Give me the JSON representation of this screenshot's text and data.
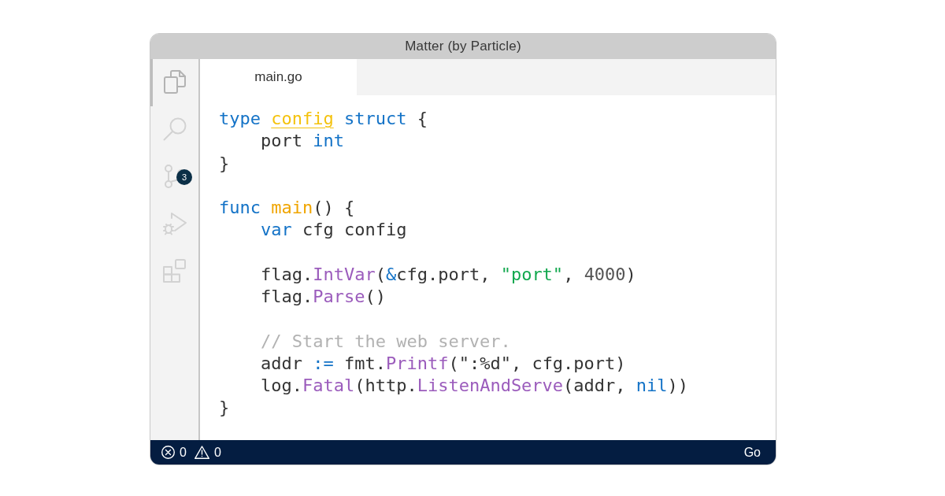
{
  "window": {
    "title": "Matter (by Particle)"
  },
  "activity_bar": {
    "items": [
      {
        "kind": "files",
        "selected": true
      },
      {
        "kind": "search",
        "selected": false
      },
      {
        "kind": "branch",
        "selected": false,
        "badge": "3"
      },
      {
        "kind": "debug",
        "selected": false
      },
      {
        "kind": "extensions",
        "selected": false
      }
    ]
  },
  "tabs": [
    {
      "label": "main.go",
      "selected": true
    }
  ],
  "code": {
    "blocks": [
      {
        "lines": [
          {
            "tokens": [
              {
                "kind": "keyword",
                "text": "type "
              },
              {
                "kind": "type-decl",
                "text": "config"
              },
              {
                "kind": "keyword",
                "text": " struct"
              },
              {
                "kind": "plain",
                "text": " {"
              }
            ],
            "children": [
              {
                "lines": [
                  {
                    "tokens": [
                      {
                        "kind": "plain",
                        "text": "port "
                      },
                      {
                        "kind": "keyword",
                        "text": "int"
                      }
                    ]
                  }
                ]
              }
            ]
          },
          {
            "tokens": [
              {
                "kind": "plain",
                "text": "}"
              }
            ]
          }
        ]
      },
      {
        "lines": [
          {
            "tokens": [
              {
                "kind": "keyword",
                "text": "func "
              },
              {
                "kind": "func-decl",
                "text": "main"
              },
              {
                "kind": "plain",
                "text": "() {"
              }
            ],
            "children": [
              {
                "lines": [
                  {
                    "tokens": [
                      {
                        "kind": "keyword",
                        "text": "var"
                      },
                      {
                        "kind": "plain",
                        "text": " cfg config"
                      }
                    ]
                  }
                ]
              },
              {
                "lines": [
                  {
                    "tokens": [
                      {
                        "kind": "plain",
                        "text": "flag."
                      },
                      {
                        "kind": "call",
                        "text": "IntVar"
                      },
                      {
                        "kind": "plain",
                        "text": "("
                      },
                      {
                        "kind": "operator",
                        "text": "&"
                      },
                      {
                        "kind": "plain",
                        "text": "cfg.port, "
                      },
                      {
                        "kind": "string",
                        "text": "\"port\""
                      },
                      {
                        "kind": "plain",
                        "text": ", "
                      },
                      {
                        "kind": "number",
                        "text": "4000"
                      },
                      {
                        "kind": "plain",
                        "text": ")"
                      }
                    ]
                  },
                  {
                    "tokens": [
                      {
                        "kind": "plain",
                        "text": "flag."
                      },
                      {
                        "kind": "call",
                        "text": "Parse"
                      },
                      {
                        "kind": "plain",
                        "text": "()"
                      }
                    ]
                  }
                ]
              },
              {
                "lines": [
                  {
                    "tokens": [
                      {
                        "kind": "comment",
                        "text": "// Start the web server."
                      }
                    ]
                  },
                  {
                    "tokens": [
                      {
                        "kind": "plain",
                        "text": "addr "
                      },
                      {
                        "kind": "operator",
                        "text": ":="
                      },
                      {
                        "kind": "plain",
                        "text": " fmt."
                      },
                      {
                        "kind": "call",
                        "text": "Printf"
                      },
                      {
                        "kind": "plain",
                        "text": "(\":%d\", cfg.port)"
                      }
                    ]
                  },
                  {
                    "tokens": [
                      {
                        "kind": "plain",
                        "text": "log."
                      },
                      {
                        "kind": "call",
                        "text": "Fatal"
                      },
                      {
                        "kind": "plain",
                        "text": "(http."
                      },
                      {
                        "kind": "call",
                        "text": "ListenAndServe"
                      },
                      {
                        "kind": "plain",
                        "text": "(addr, "
                      },
                      {
                        "kind": "keyword",
                        "text": "nil"
                      },
                      {
                        "kind": "plain",
                        "text": "))"
                      }
                    ]
                  }
                ]
              }
            ]
          },
          {
            "tokens": [
              {
                "kind": "plain",
                "text": "}"
              }
            ]
          }
        ]
      }
    ]
  },
  "status_bar": {
    "errors": "0",
    "warnings": "0",
    "language": "Go"
  }
}
